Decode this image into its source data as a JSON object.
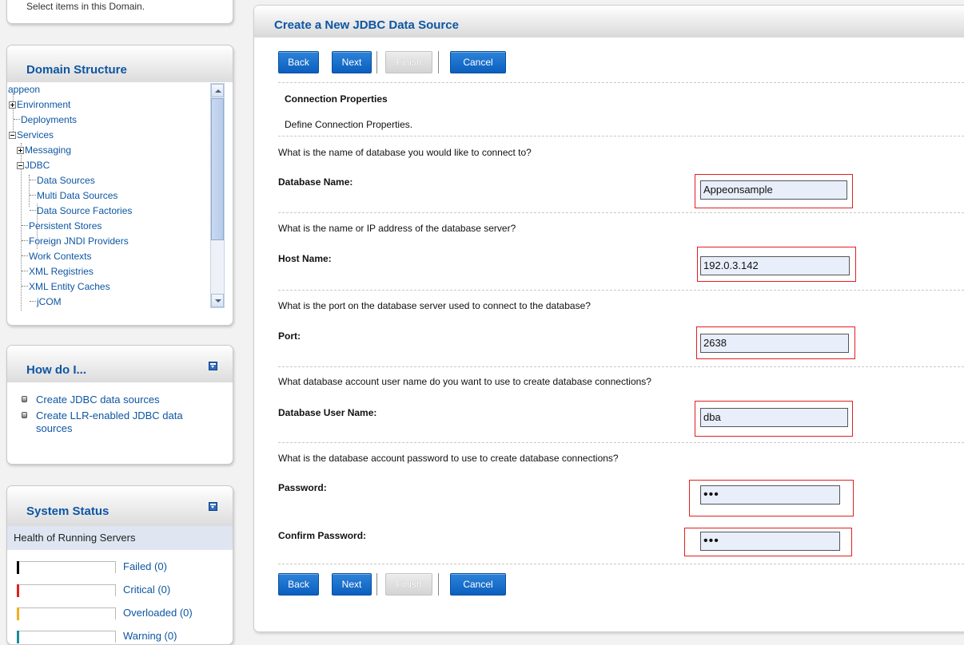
{
  "top_panel": {
    "partial_text": "Select items in this Domain."
  },
  "domain_structure": {
    "title": "Domain Structure",
    "root": "appeon",
    "items": [
      {
        "label": "Environment"
      },
      {
        "label": "Deployments"
      },
      {
        "label": "Services"
      },
      {
        "label": "Messaging"
      },
      {
        "label": "JDBC"
      },
      {
        "label": "Data Sources"
      },
      {
        "label": "Multi Data Sources"
      },
      {
        "label": "Data Source Factories"
      },
      {
        "label": "Persistent Stores"
      },
      {
        "label": "Foreign JNDI Providers"
      },
      {
        "label": "Work Contexts"
      },
      {
        "label": "XML Registries"
      },
      {
        "label": "XML Entity Caches"
      },
      {
        "label": "jCOM"
      }
    ]
  },
  "how_do_i": {
    "title": "How do I...",
    "items": [
      {
        "label": "Create JDBC data sources"
      },
      {
        "label": "Create LLR-enabled JDBC data sources"
      }
    ]
  },
  "system_status": {
    "title": "System Status",
    "health_title": "Health of Running Servers",
    "rows": [
      {
        "label": "Failed (0)",
        "color": "#000000"
      },
      {
        "label": "Critical (0)",
        "color": "#e02020"
      },
      {
        "label": "Overloaded (0)",
        "color": "#f0b020"
      },
      {
        "label": "Warning (0)",
        "color": "#1a8a9a"
      }
    ]
  },
  "main": {
    "title": "Create a New JDBC Data Source",
    "buttons": {
      "back": "Back",
      "next": "Next",
      "finish": "Finish",
      "cancel": "Cancel"
    },
    "section_title": "Connection Properties",
    "section_desc": "Define Connection Properties.",
    "fields": {
      "db_name": {
        "question": "What is the name of database you would like to connect to?",
        "label": "Database Name:",
        "value": "Appeonsample"
      },
      "host": {
        "question": "What is the name or IP address of the database server?",
        "label": "Host Name:",
        "value": "192.0.3.142"
      },
      "port": {
        "question": "What is the port on the database server used to connect to the database?",
        "label": "Port:",
        "value": "2638"
      },
      "user": {
        "question": "What database account user name do you want to use to create database connections?",
        "label": "Database User Name:",
        "value": "dba"
      },
      "password": {
        "question": "What is the database account password to use to create database connections?",
        "label": "Password:",
        "value": "•••"
      },
      "confirm": {
        "label": "Confirm Password:",
        "value": "•••"
      }
    }
  },
  "colors": {
    "link": "#0e56a3",
    "button": "#1a6fcc",
    "highlight": "#e02020"
  }
}
